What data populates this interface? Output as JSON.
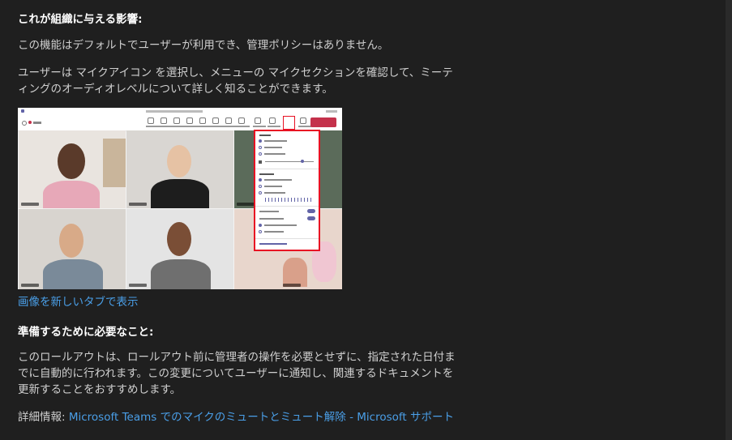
{
  "section1": {
    "heading": "これが組織に与える影響:",
    "para1": "この機能はデフォルトでユーザーが利用でき、管理ポリシーはありません。",
    "para2_line1": "ユーザーは マイクアイコン を選択し、メニューの マイクセクションを確認して、ミーテ",
    "para2_line2": "ィングのオーディオレベルについて詳しく知ることができます。"
  },
  "image": {
    "open_new_tab": "画像を新しいタブで表示"
  },
  "section2": {
    "heading": "準備するために必要なこと:",
    "line1": "このロールアウトは、ロールアウト前に管理者の操作を必要とせずに、指定された日付ま",
    "line2": "でに自動的に行われます。この変更についてユーザーに通知し、関連するドキュメントを",
    "line3": "更新することをおすすめします。"
  },
  "more_info": {
    "label": "詳細情報: ",
    "link": "Microsoft Teams でのマイクのミュートとミュート解除 - Microsoft サポート"
  },
  "colors": {
    "background": "#1f1f1f",
    "link": "#4a9fe8",
    "highlight": "#e81123",
    "teams_purple": "#6264a7"
  }
}
